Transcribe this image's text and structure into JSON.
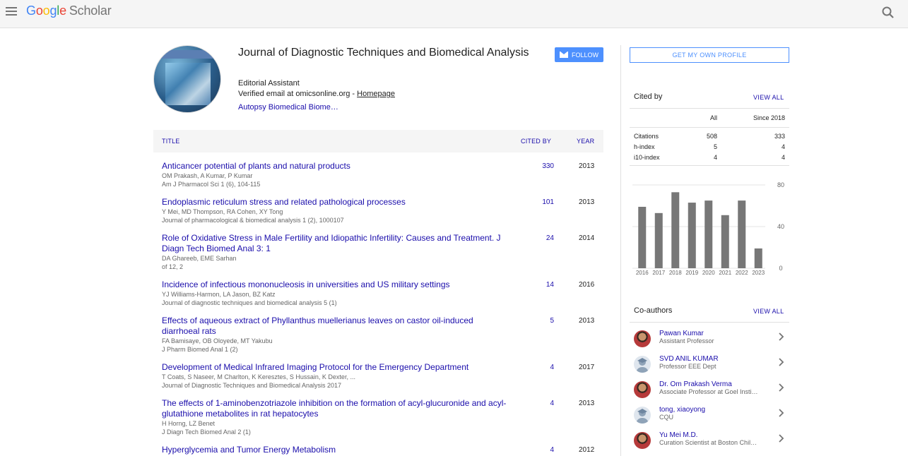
{
  "app": {
    "logo_parts": [
      "G",
      "o",
      "o",
      "g",
      "l",
      "e"
    ],
    "logo_suffix": "Scholar"
  },
  "profile": {
    "name": "Journal of Diagnostic Techniques and Biomedical Analysis",
    "affiliation": "Editorial Assistant",
    "email_text": "Verified email at omicsonline.org - ",
    "homepage_label": "Homepage",
    "interest": "Autopsy Biomedical Biome…",
    "follow_label": "FOLLOW"
  },
  "table": {
    "headers": {
      "title": "TITLE",
      "cited_by": "CITED BY",
      "year": "YEAR"
    },
    "rows": [
      {
        "title": "Anticancer potential of plants and natural products",
        "authors": "OM Prakash, A Kumar, P Kumar",
        "source": "Am J Pharmacol Sci 1 (6), 104-115",
        "cited": "330",
        "year": "2013"
      },
      {
        "title": "Endoplasmic reticulum stress and related pathological processes",
        "authors": "Y Mei, MD Thompson, RA Cohen, XY Tong",
        "source": "Journal of pharmacological & biomedical analysis 1 (2), 1000107",
        "cited": "101",
        "year": "2013"
      },
      {
        "title": "Role of Oxidative Stress in Male Fertility and Idiopathic Infertility: Causes and Treatment. J Diagn Tech Biomed Anal 3: 1",
        "authors": "DA Ghareeb, EME Sarhan",
        "source": "of 12, 2",
        "cited": "24",
        "year": "2014"
      },
      {
        "title": "Incidence of infectious mononucleosis in universities and US military settings",
        "authors": "YJ Williams-Harmon, LA Jason, BZ Katz",
        "source": "Journal of diagnostic techniques and biomedical analysis 5 (1)",
        "cited": "14",
        "year": "2016"
      },
      {
        "title": "Effects of aqueous extract of Phyllanthus muellerianus leaves on castor oil-induced diarrhoeal rats",
        "authors": "FA Bamisaye, OB Oloyede, MT Yakubu",
        "source": "J Pharm Biomed Anal 1 (2)",
        "cited": "5",
        "year": "2013"
      },
      {
        "title": "Development of Medical Infrared Imaging Protocol for the Emergency Department",
        "authors": "T Coats, S Naseer, M Charlton, K Keresztes, S Hussain, K Dexter, ...",
        "source": "Journal of Diagnostic Techniques and Biomedical Analysis 2017",
        "cited": "4",
        "year": "2017"
      },
      {
        "title": "The effects of 1-aminobenzotriazole inhibition on the formation of acyl-glucuronide and acyl-glutathione metabolites in rat hepatocytes",
        "authors": "H Horng, LZ Benet",
        "source": "J Diagn Tech Biomed Anal 2 (1)",
        "cited": "4",
        "year": "2013"
      },
      {
        "title": "Hyperglycemia and Tumor Energy Metabolism",
        "authors": "",
        "source": "",
        "cited": "4",
        "year": "2012"
      }
    ]
  },
  "sidebar": {
    "get_profile_label": "GET MY OWN PROFILE",
    "cited_by": {
      "heading": "Cited by",
      "view_all": "VIEW ALL",
      "col_all": "All",
      "col_since": "Since 2018",
      "rows": [
        {
          "label": "Citations",
          "all": "508",
          "since": "333"
        },
        {
          "label": "h-index",
          "all": "5",
          "since": "4"
        },
        {
          "label": "i10-index",
          "all": "4",
          "since": "4"
        }
      ]
    },
    "coauthors": {
      "heading": "Co-authors",
      "view_all": "VIEW ALL",
      "items": [
        {
          "name": "Pawan Kumar",
          "affiliation": "Assistant Professor",
          "avatar": "photo"
        },
        {
          "name": "SVD ANIL KUMAR",
          "affiliation": "Professor EEE Dept",
          "avatar": "default"
        },
        {
          "name": "Dr. Om Prakash Verma",
          "affiliation": "Associate Professor at Goel Insti…",
          "avatar": "photo"
        },
        {
          "name": "tong, xiaoyong",
          "affiliation": "CQU",
          "avatar": "default"
        },
        {
          "name": "Yu Mei M.D.",
          "affiliation": "Curation Scientist at Boston Chil…",
          "avatar": "photo"
        }
      ]
    }
  },
  "chart_data": {
    "type": "bar",
    "categories": [
      "2016",
      "2017",
      "2018",
      "2019",
      "2020",
      "2021",
      "2022",
      "2023"
    ],
    "values": [
      59,
      53,
      73,
      63,
      65,
      51,
      65,
      19
    ],
    "ylim": [
      0,
      80
    ],
    "yticks": [
      "80",
      "40",
      "0"
    ],
    "grid": true,
    "color": "#777777"
  }
}
